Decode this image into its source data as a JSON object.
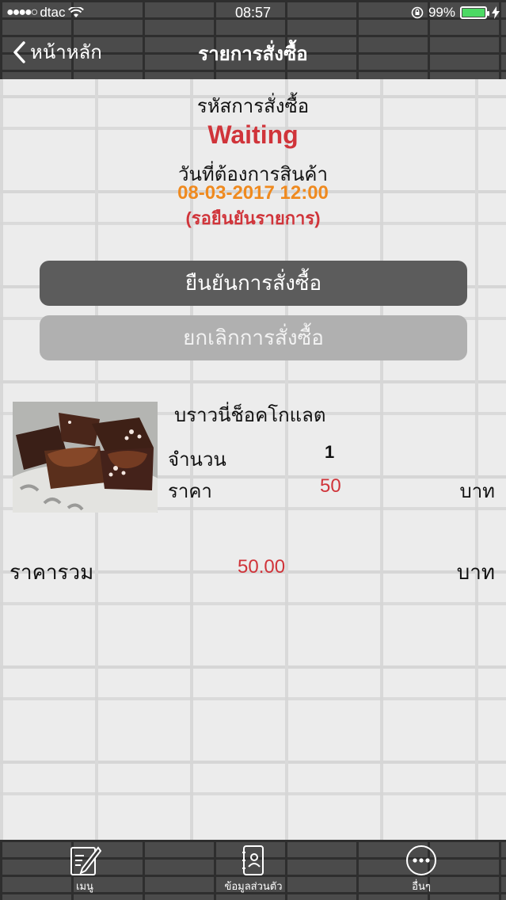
{
  "status_bar": {
    "carrier": "dtac",
    "time": "08:57",
    "battery": "99%"
  },
  "nav": {
    "back_label": "หน้าหลัก",
    "title": "รายการสั่งซื้อ"
  },
  "order": {
    "code_label": "รหัสการสั่งซื้อ",
    "status": "Waiting",
    "date_label": "วันที่ต้องการสินค้า",
    "date_value": "08-03-2017 12:00",
    "confirm_note": "(รอยืนยันรายการ)"
  },
  "buttons": {
    "confirm": "ยืนยันการสั่งซื้อ",
    "cancel": "ยกเลิกการสั่งซื้อ"
  },
  "item": {
    "name": "บราวนี่ช็อคโกแลต",
    "qty_label": "จำนวน",
    "qty": "1",
    "price_label": "ราคา",
    "price": "50",
    "unit": "บาท"
  },
  "total": {
    "label": "ราคารวม",
    "value": "50.00",
    "unit": "บาท"
  },
  "tabbar": {
    "tabs": [
      {
        "label": "เมนู",
        "icon": "menu-edit-icon"
      },
      {
        "label": "ข้อมูลส่วนตัว",
        "icon": "contacts-book-icon"
      },
      {
        "label": "อื่นๆ",
        "icon": "more-icon"
      }
    ]
  },
  "colors": {
    "status_red": "#d0343a",
    "date_orange": "#ef8a1f",
    "confirm_button": "#5c5c5c",
    "cancel_button": "#b0b0b0"
  }
}
